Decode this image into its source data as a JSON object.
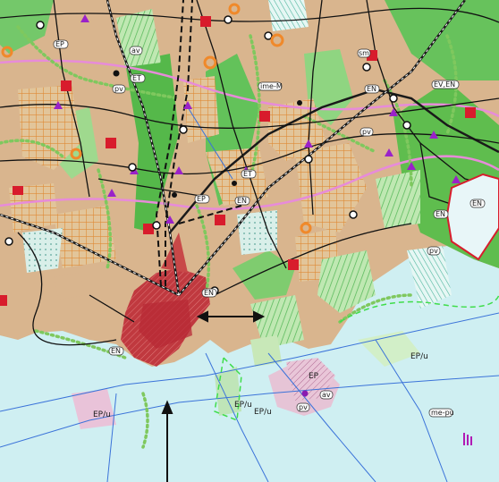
{
  "colors": {
    "sea": "#cfeff2",
    "land_base": "#d9b38c",
    "green_area": "#53b848",
    "light_green": "#9ed98a",
    "hatch_orange": "#e08a2a",
    "road": "#111111",
    "rail": "#555555",
    "red_block": "#d71c2a",
    "city_red": "#c23a3a",
    "purple_line": "#e07ad6",
    "blue_line": "#2f6fd6",
    "green_dotted": "#7fc85e",
    "purple_triangle": "#9a22c9",
    "pink_zone": "#e9a7cc",
    "ep_zone": "#c98fb0"
  },
  "labels": {
    "ep_u_1": "EP/u",
    "ep_u_2": "EP/u",
    "ep_u_3": "EP/u",
    "ep_u_4": "EP/u",
    "ep": "EP",
    "en_1": "EN",
    "en_2": "EN",
    "en_3": "EN",
    "en_4": "EN",
    "en_5": "EN",
    "ep_small": "EP",
    "et_1": "ET",
    "et_2": "ET",
    "ep_2": "EP",
    "ev_en": "EV,EN",
    "ime_m": "ime-M",
    "me_pu": "me-pu",
    "pv_1": "pv",
    "pv_2": "pv",
    "pv_3": "pv",
    "pv_4": "pv",
    "av_1": "av",
    "av_2": "av",
    "sm": "sm",
    "en_6": "EN"
  }
}
